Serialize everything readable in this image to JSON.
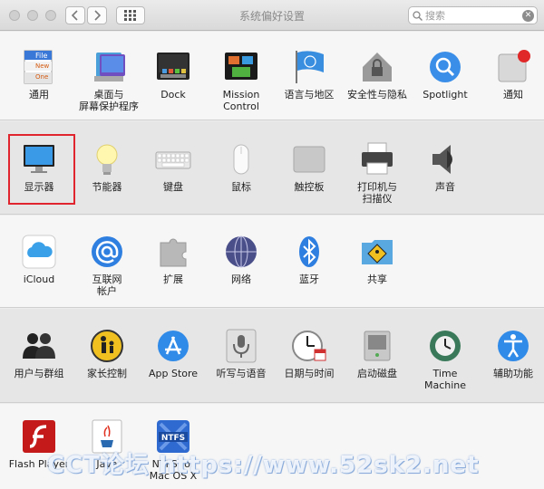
{
  "window": {
    "title": "系统偏好设置"
  },
  "nav": {
    "back_icon": "chevron-left-icon",
    "forward_icon": "chevron-right-icon",
    "show_all_icon": "grid-icon"
  },
  "search": {
    "placeholder": "搜索",
    "value": ""
  },
  "colors": {
    "highlight": "#e0252f",
    "accent_blue": "#2f7fe0"
  },
  "rows": [
    [
      {
        "label": "通用",
        "icon": "general-icon"
      },
      {
        "label": "桌面与\n屏幕保护程序",
        "icon": "desktop-screensaver-icon"
      },
      {
        "label": "Dock",
        "icon": "dock-icon"
      },
      {
        "label": "Mission\nControl",
        "icon": "mission-control-icon"
      },
      {
        "label": "语言与地区",
        "icon": "language-region-icon"
      },
      {
        "label": "安全性与隐私",
        "icon": "security-privacy-icon"
      },
      {
        "label": "Spotlight",
        "icon": "spotlight-icon"
      },
      {
        "label": "通知",
        "icon": "notifications-icon"
      }
    ],
    [
      {
        "label": "显示器",
        "icon": "displays-icon"
      },
      {
        "label": "节能器",
        "icon": "energy-saver-icon"
      },
      {
        "label": "键盘",
        "icon": "keyboard-icon"
      },
      {
        "label": "鼠标",
        "icon": "mouse-icon"
      },
      {
        "label": "触控板",
        "icon": "trackpad-icon"
      },
      {
        "label": "打印机与\n扫描仪",
        "icon": "printer-scanner-icon"
      },
      {
        "label": "声音",
        "icon": "sound-icon"
      }
    ],
    [
      {
        "label": "iCloud",
        "icon": "icloud-icon"
      },
      {
        "label": "互联网\n帐户",
        "icon": "internet-accounts-icon"
      },
      {
        "label": "扩展",
        "icon": "extensions-icon"
      },
      {
        "label": "网络",
        "icon": "network-icon"
      },
      {
        "label": "蓝牙",
        "icon": "bluetooth-icon"
      },
      {
        "label": "共享",
        "icon": "sharing-icon"
      }
    ],
    [
      {
        "label": "用户与群组",
        "icon": "users-groups-icon"
      },
      {
        "label": "家长控制",
        "icon": "parental-controls-icon"
      },
      {
        "label": "App Store",
        "icon": "app-store-icon"
      },
      {
        "label": "听写与语音",
        "icon": "dictation-speech-icon"
      },
      {
        "label": "日期与时间",
        "icon": "date-time-icon"
      },
      {
        "label": "启动磁盘",
        "icon": "startup-disk-icon"
      },
      {
        "label": "Time Machine",
        "icon": "time-machine-icon"
      },
      {
        "label": "辅助功能",
        "icon": "accessibility-icon"
      }
    ],
    [
      {
        "label": "Flash Player",
        "icon": "flash-player-icon"
      },
      {
        "label": "Java",
        "icon": "java-icon"
      },
      {
        "label": "NTFS for\nMac OS X",
        "icon": "ntfs-icon"
      }
    ]
  ],
  "icon_text": {
    "general_file": "File",
    "general_new": "New",
    "general_one": "One",
    "ntfs": "NTFS"
  },
  "watermark": "CCT论坛 https://www.52sk2.net"
}
